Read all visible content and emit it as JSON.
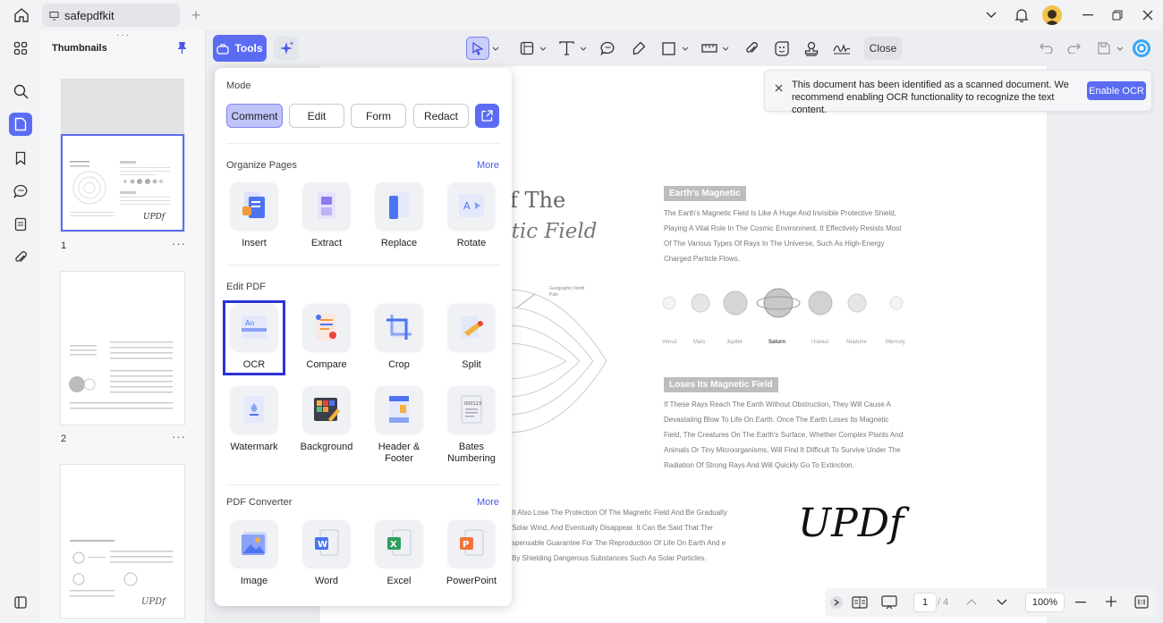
{
  "window": {
    "tab_title": "safepdfkit"
  },
  "thumbnails": {
    "title": "Thumbnails",
    "pages": [
      "1",
      "2"
    ],
    "more": "···"
  },
  "toolbar": {
    "tools_label": "Tools",
    "close_label": "Close"
  },
  "popup": {
    "mode_title": "Mode",
    "modes": [
      "Comment",
      "Edit",
      "Form",
      "Redact"
    ],
    "organize_title": "Organize Pages",
    "organize_more": "More",
    "organize": [
      "Insert",
      "Extract",
      "Replace",
      "Rotate"
    ],
    "edit_title": "Edit PDF",
    "edit": [
      "OCR",
      "Compare",
      "Crop",
      "Split",
      "Watermark",
      "Background",
      "Header &\nFooter",
      "Bates\nNumbering"
    ],
    "converter_title": "PDF Converter",
    "converter_more": "More",
    "converter": [
      "Image",
      "Word",
      "Excel",
      "PowerPoint"
    ]
  },
  "notice": {
    "text": "This document has been identified as a scanned document. We recommend enabling OCR functionality to recognize the text content.",
    "button": "Enable OCR"
  },
  "document": {
    "title_line1": "f The",
    "title_line2": "etic Field",
    "section1_heading": "Earth's Magnetic",
    "section1_body": "The Earth's Magnetic Field Is Like A Huge And Invisible Protective Shield, Playing A Vital Role In The Cosmic Environment. It Effectively Resists Most Of The Various Types Of Rays In The Universe, Such As High-Energy Charged Particle Flows.",
    "planets": [
      "Venus",
      "Mars",
      "Jupiter",
      "Saturn",
      "Uranus",
      "Neptune",
      "Mercury"
    ],
    "diagram_label": "Geographic North Pole",
    "section2_heading": "Loses Its Magnetic Field",
    "section2_body": "If These Rays Reach The Earth Without Obstruction, They Will Cause A Devastating Blow To Life On Earth. Once The Earth Loses Its Magnetic Field, The Creatures On The Earth's Surface, Whether Complex Plants And Animals Or Tiny Microorganisms, Will Find It Difficult To Survive Under The Radiation Of Strong Rays And Will Quickly Go To Extinction.",
    "bottom_text": "It Also Lose The Protection Of The Magnetic Field And Be Gradually Solar Wind, And Eventually Disappear. It Can Be Said That The spensable Guarantee For The Reproduction Of Life On Earth And e By Shielding Dangerous Substances Such As Solar Particles.",
    "signature": "UPDf"
  },
  "bottombar": {
    "page": "1",
    "total": "/ 4",
    "zoom": "100%"
  }
}
